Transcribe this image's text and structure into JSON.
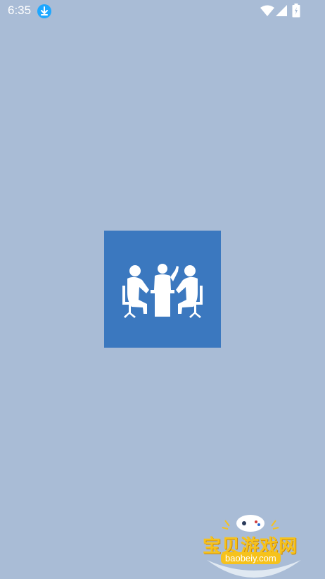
{
  "status_bar": {
    "time": "6:35",
    "icons": [
      "download-icon",
      "wifi-icon",
      "signal-icon",
      "battery-icon"
    ]
  },
  "splash": {
    "background_color": "#a9bcd6",
    "logo_color": "#3b78bf",
    "logo_icon": "meeting-people-icon"
  },
  "watermark": {
    "title": "宝贝游戏网",
    "url": "baobeiy.com",
    "icon": "gamepad-icon"
  }
}
